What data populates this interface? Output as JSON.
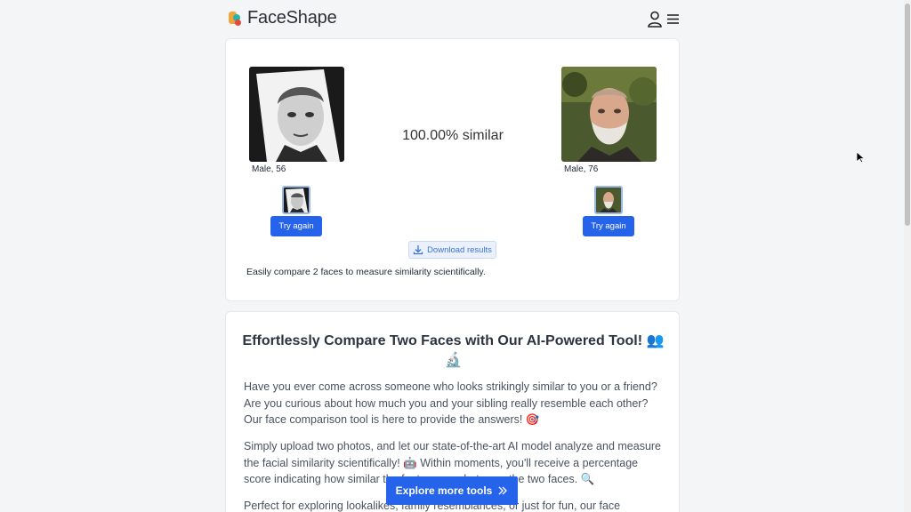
{
  "header": {
    "logo_text": "FaceShape",
    "icons": [
      "user-icon",
      "menu-icon"
    ]
  },
  "compare": {
    "left": {
      "label": "Male, 56",
      "button": "Try again"
    },
    "right": {
      "label": "Male, 76",
      "button": "Try again"
    },
    "similarity": "100.00% similar",
    "download_label": "Download results",
    "caption": "Easily compare 2 faces to measure similarity scientifically."
  },
  "article": {
    "title": "Effortlessly Compare Two Faces with Our AI-Powered Tool! 👥🔬",
    "p1": "Have you ever come across someone who looks strikingly similar to you or a friend? Are you curious about how much you and your sibling really resemble each other? Our face comparison tool is here to provide the answers! 🎯",
    "p2": "Simply upload two photos, and let our state-of-the-art AI model analyze and measure the facial similarity scientifically! 🤖 Within moments, you'll receive a percentage score indicating how similar the features are between the two faces. 🔍",
    "p3": "Perfect for exploring lookalikes, family resemblances, or just for fun, our face"
  },
  "explore_button": "Explore more tools",
  "colors": {
    "primary": "#2563eb",
    "background": "#f4f5f7",
    "card": "#ffffff"
  }
}
